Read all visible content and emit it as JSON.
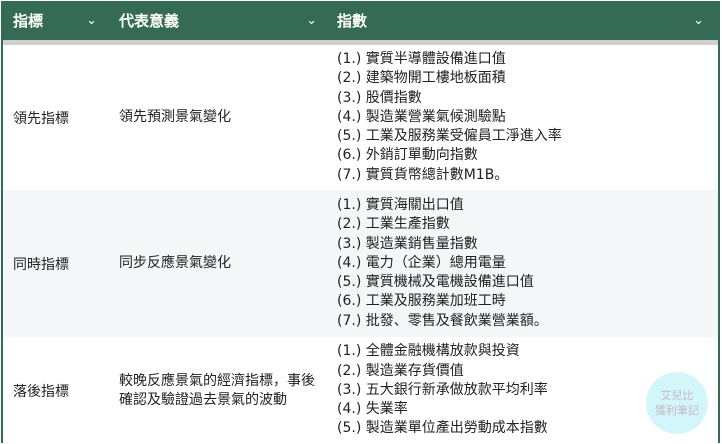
{
  "header": {
    "col1": "指標",
    "col2": "代表意義",
    "col3": "指數"
  },
  "rows": [
    {
      "name": "領先指標",
      "meaning": "領先預測景氣變化",
      "items": [
        "(1.) 實質半導體設備進口值",
        "(2.) 建築物開工樓地板面積",
        "(3.) 股價指數",
        "(4.) 製造業營業氣候測驗點",
        "(5.) 工業及服務業受僱員工淨進入率",
        "(6.) 外銷訂單動向指數",
        "(7.) 實質貨幣總計數M1B。"
      ]
    },
    {
      "name": "同時指標",
      "meaning": "同步反應景氣變化",
      "items": [
        "(1.) 實質海關出口值",
        "(2.) 工業生產指數",
        "(3.) 製造業銷售量指數",
        "(4.) 電力（企業）總用電量",
        "(5.) 實質機械及電機設備進口值",
        "(6.) 工業及服務業加班工時",
        "(7.) 批發、零售及餐飲業營業額。"
      ]
    },
    {
      "name": "落後指標",
      "meaning": "較晚反應景氣的經濟指標，事後確認及驗證過去景氣的波動",
      "items": [
        "(1.) 全體金融機構放款與投資",
        "(2.) 製造業存貨價值",
        "(3.) 五大銀行新承做放款平均利率",
        "(4.) 失業率",
        "(5.) 製造業單位產出勞動成本指數"
      ]
    }
  ],
  "watermark": {
    "line1": "艾兒比",
    "line2": "獲利筆記"
  }
}
